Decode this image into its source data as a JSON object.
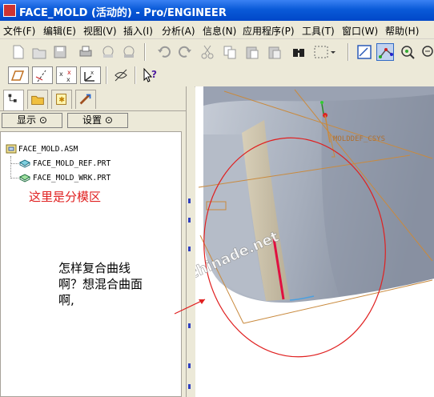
{
  "window": {
    "title": "FACE_MOLD (活动的) - Pro/ENGINEER"
  },
  "menu": [
    "文件(F)",
    "编辑(E)",
    "视图(V)",
    "插入(I)",
    "分析(A)",
    "信息(N)",
    "应用程序(P)",
    "工具(T)",
    "窗口(W)",
    "帮助(H)"
  ],
  "toolbar1": [
    "new-icon",
    "open-icon",
    "save-icon",
    "print-icon",
    "email-icon",
    "email-attach-icon",
    "undo-icon",
    "redo-icon",
    "cut-icon",
    "copy-icon",
    "paste-icon",
    "paste-special-icon",
    "binoculars-icon",
    "select-box-icon",
    "sketch-icon",
    "datum-point-icon",
    "regenerate-icon",
    "zoom-icon"
  ],
  "toolbar2": [
    "datum-plane-icon",
    "datum-axis-icon",
    "datum-point-display-icon",
    "coord-sys-icon",
    "spin-center-icon",
    "whats-this-icon"
  ],
  "left_panel": {
    "show_button": "显示",
    "settings_button": "设置",
    "tree": [
      "FACE_MOLD.ASM",
      "FACE_MOLD_REF.PRT",
      "FACE_MOLD_WRK.PRT"
    ]
  },
  "annotations": {
    "submodel_area": "这里是分模区",
    "question_lines": [
      "怎样复合曲线",
      "啊？想混合曲面",
      "啊,"
    ],
    "watermark": "bbs.chinade.net"
  },
  "viewport": {
    "csys_label": "MOLDDEF_CSYS"
  },
  "colors": {
    "title_bar": "#0a5ad8",
    "annotation_red": "#e02020",
    "datum": "#d58a3a"
  }
}
